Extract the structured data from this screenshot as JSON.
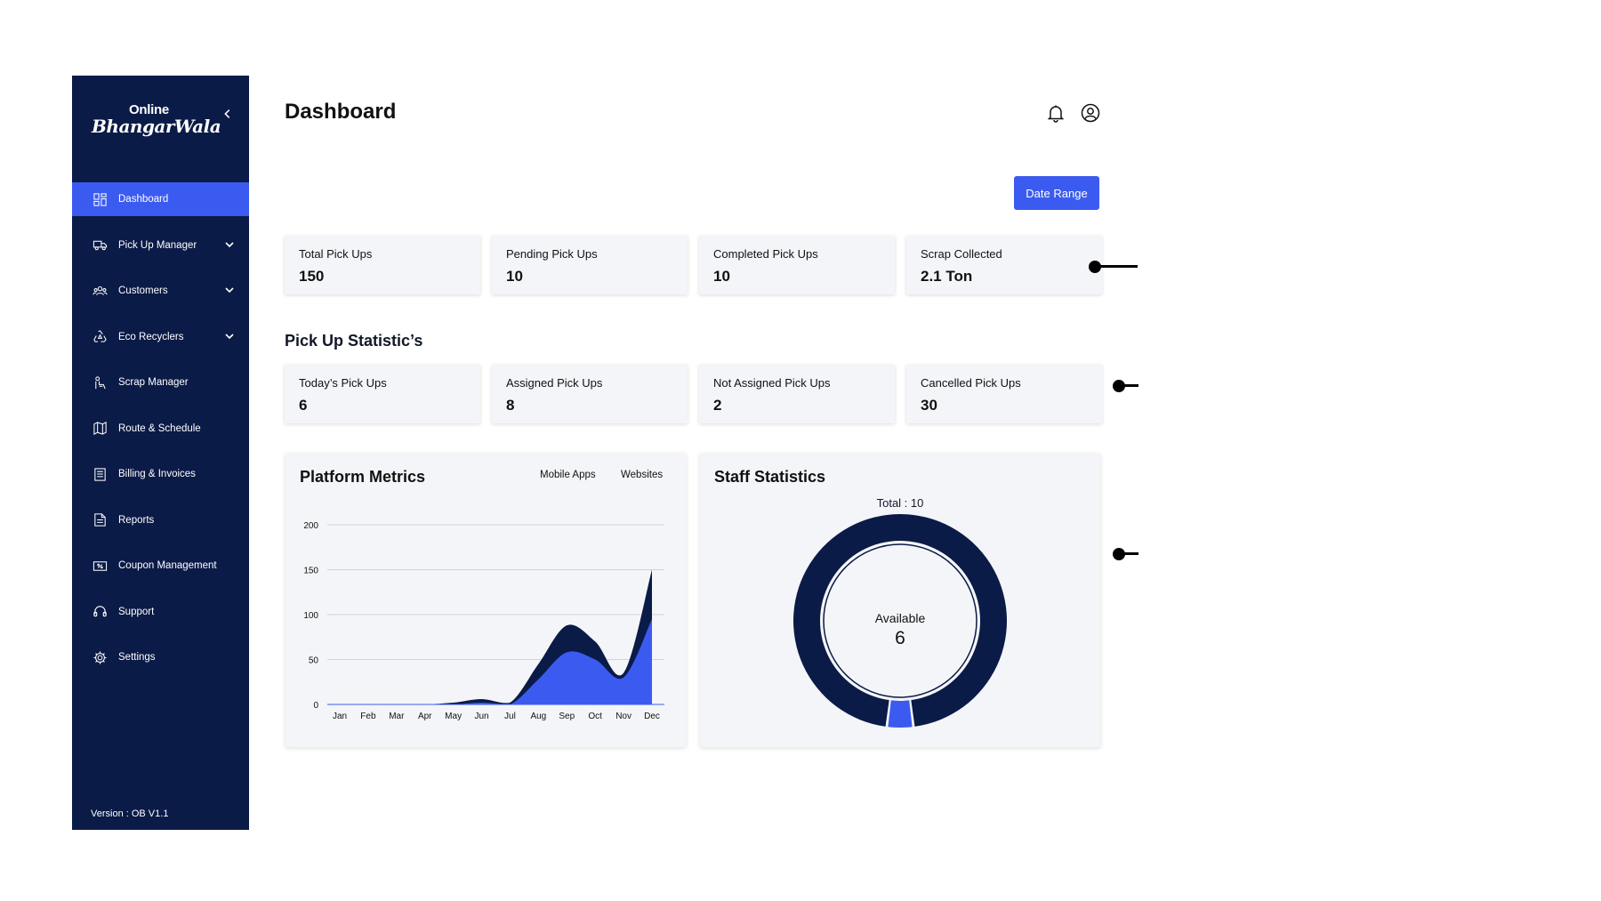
{
  "brand": {
    "line1": "Online",
    "line2": "BhangarWala"
  },
  "sidebar": {
    "items": [
      {
        "label": "Dashboard",
        "icon": "grid-icon",
        "active": true,
        "expandable": false
      },
      {
        "label": "Pick Up Manager",
        "icon": "truck-icon",
        "active": false,
        "expandable": true
      },
      {
        "label": "Customers",
        "icon": "users-icon",
        "active": false,
        "expandable": true
      },
      {
        "label": "Eco Recyclers",
        "icon": "recycle-icon",
        "active": false,
        "expandable": true
      },
      {
        "label": "Scrap Manager",
        "icon": "scrap-icon",
        "active": false,
        "expandable": false
      },
      {
        "label": "Route & Schedule",
        "icon": "map-icon",
        "active": false,
        "expandable": false
      },
      {
        "label": "Billing & Invoices",
        "icon": "invoice-icon",
        "active": false,
        "expandable": false
      },
      {
        "label": "Reports",
        "icon": "report-icon",
        "active": false,
        "expandable": false
      },
      {
        "label": "Coupon Management",
        "icon": "coupon-icon",
        "active": false,
        "expandable": false
      },
      {
        "label": "Support",
        "icon": "headset-icon",
        "active": false,
        "expandable": false
      },
      {
        "label": "Settings",
        "icon": "gear-icon",
        "active": false,
        "expandable": false
      }
    ],
    "version": "Version : OB V1.1"
  },
  "header": {
    "title": "Dashboard",
    "date_range_label": "Date Range"
  },
  "summary_cards": [
    {
      "label": "Total Pick Ups",
      "value": "150"
    },
    {
      "label": "Pending Pick Ups",
      "value": "10"
    },
    {
      "label": "Completed Pick Ups",
      "value": "10"
    },
    {
      "label": "Scrap Collected",
      "value": "2.1 Ton"
    }
  ],
  "pickup_stats": {
    "title": "Pick Up Statistic’s",
    "cards": [
      {
        "label": "Today’s Pick Ups",
        "value": "6"
      },
      {
        "label": "Assigned Pick Ups",
        "value": "8"
      },
      {
        "label": "Not Assigned Pick Ups",
        "value": "2"
      },
      {
        "label": "Cancelled Pick Ups",
        "value": "30"
      }
    ]
  },
  "platform_metrics": {
    "title": "Platform Metrics",
    "legend": [
      "Mobile Apps",
      "Websites"
    ]
  },
  "staff_statistics": {
    "title": "Staff Statistics",
    "total_label": "Total : 10",
    "center_label": "Available",
    "center_value": "6"
  },
  "chart_data": [
    {
      "type": "area",
      "title": "Platform Metrics",
      "categories": [
        "Jan",
        "Feb",
        "Mar",
        "Apr",
        "May",
        "Jun",
        "Jul",
        "Aug",
        "Sep",
        "Oct",
        "Nov",
        "Dec"
      ],
      "ylim": [
        0,
        200
      ],
      "yticks": [
        0,
        50,
        100,
        150,
        200
      ],
      "grid": true,
      "legend": "top-right",
      "series": [
        {
          "name": "Mobile Apps",
          "color": "#0b1b47",
          "values": [
            0,
            0,
            0,
            0,
            2,
            6,
            2,
            45,
            88,
            70,
            35,
            150
          ]
        },
        {
          "name": "Websites",
          "color": "#3b5bf0",
          "values": [
            0,
            0,
            0,
            0,
            0,
            2,
            0,
            28,
            58,
            50,
            30,
            95
          ]
        }
      ]
    },
    {
      "type": "pie",
      "title": "Staff Statistics",
      "total": 10,
      "slices": [
        {
          "value": 9.6,
          "color": "#0b1b47"
        },
        {
          "value": 0.4,
          "color": "#3b5bf0"
        }
      ]
    }
  ],
  "colors": {
    "sidebar_bg": "#0b1b47",
    "accent": "#3b5bf0",
    "card_bg": "#f4f5f8"
  }
}
